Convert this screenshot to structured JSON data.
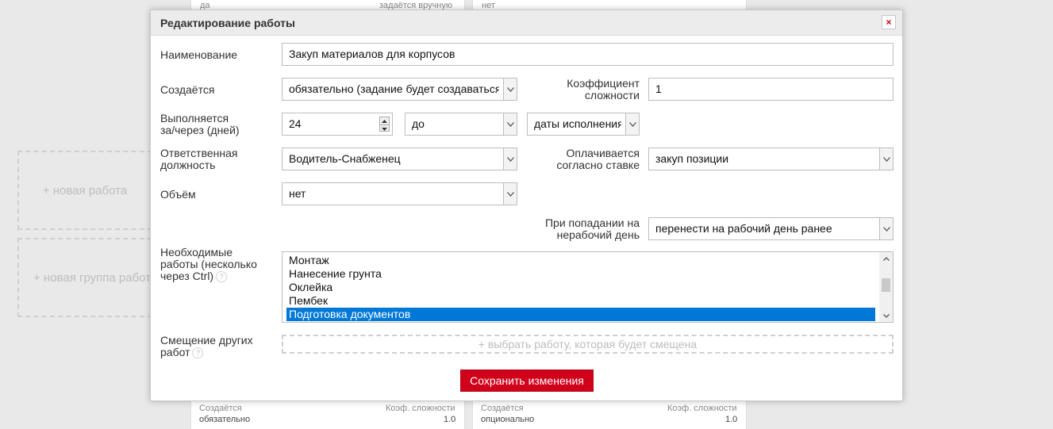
{
  "background": {
    "top_left_text": "да",
    "top_mid_text": "задаётся вручную",
    "top_right_text": "нет",
    "new_work": "+ новая работа",
    "new_group": "+ новая группа работ",
    "card1": {
      "created_label": "Создаётся",
      "created_value": "обязательно",
      "coef_label": "Коэф. сложности",
      "coef_value": "1.0"
    },
    "card2": {
      "created_label": "Создаётся",
      "created_value": "опционально",
      "coef_label": "Коэф. сложности",
      "coef_value": "1.0"
    }
  },
  "modal": {
    "title": "Редактирование работы",
    "close_label": "×",
    "fields": {
      "name_label": "Наименование",
      "name_value": "Закуп материалов для корпусов",
      "created_label": "Создаётся",
      "created_value": "обязательно (задание будет создаваться",
      "coef_label_line1": "Коэффициент",
      "coef_label_line2": "сложности",
      "coef_value": "1",
      "exec_label_line1": "Выполняется",
      "exec_label_line2": "за/через (дней)",
      "exec_days": "24",
      "exec_relation": "до",
      "exec_date": "даты исполнения",
      "resp_label_line1": "Ответственная",
      "resp_label_line2": "должность",
      "resp_value": "Водитель-Снабженец",
      "paid_label_line1": "Оплачивается",
      "paid_label_line2": "согласно ставке",
      "paid_value": "закуп позиции",
      "volume_label": "Объём",
      "volume_value": "нет",
      "holiday_label_line1": "При попадании на",
      "holiday_label_line2": "нерабочий день",
      "holiday_value": "перенести на рабочий день ранее",
      "required_label_line1": "Необходимые",
      "required_label_line2": "работы (несколько",
      "required_label_line3": "через Ctrl)",
      "required_items": [
        "Монтаж",
        "Нанесение грунта",
        "Оклейка",
        "Пембек",
        "Подготовка документов"
      ],
      "shift_label_line1": "Смещение других",
      "shift_label_line2": "работ",
      "shift_placeholder": "+ выбрать работу, которая будет смещена",
      "help_icon": "?"
    },
    "save_label": "Сохранить изменения"
  }
}
